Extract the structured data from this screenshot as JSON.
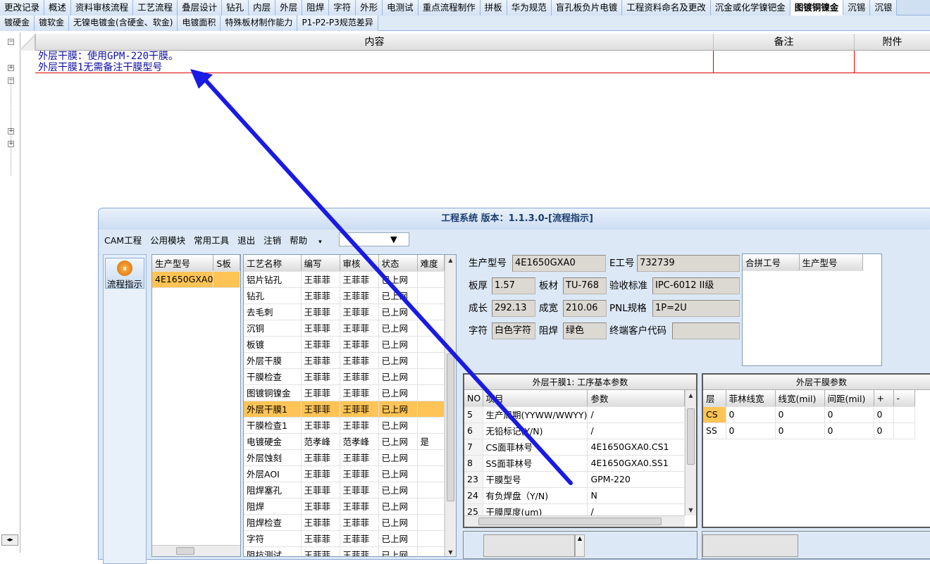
{
  "tabs_row1": [
    "更改记录",
    "概述",
    "资料审核流程",
    "工艺流程",
    "叠层设计",
    "钻孔",
    "内层",
    "外层",
    "阻焊",
    "字符",
    "外形",
    "电测试",
    "重点流程制作",
    "拼板",
    "华为规范",
    "盲孔板负片电镀",
    "工程资料命名及更改",
    "沉金或化学镍钯金",
    "图镀铜镍金",
    "沉锡",
    "沉银"
  ],
  "tabs_row1_active": "图镀铜镍金",
  "tabs_row2": [
    "镀硬金",
    "镀软金",
    "无镍电镀金(含硬金、软金)",
    "电镀面积",
    "特殊板材制作能力",
    "P1-P2-P3规范差异"
  ],
  "grid": {
    "col_content": "内容",
    "col_remark": "备注",
    "col_attach": "附件",
    "line1": "外层干膜：使用GPM-220干膜。",
    "line2": "外层干膜1无需备注干膜型号"
  },
  "window": {
    "title": "工程系统 版本：1.1.3.0-[流程指示]",
    "menu": [
      "CAM工程",
      "公用模块",
      "常用工具",
      "退出",
      "注销",
      "帮助"
    ],
    "side_button": "流程指示"
  },
  "product_list": {
    "headers": [
      "生产型号",
      "S板"
    ],
    "rows": [
      [
        "4E1650GXA0",
        ""
      ]
    ]
  },
  "process_table": {
    "headers": [
      "工艺名称",
      "编写",
      "审核",
      "状态",
      "难度"
    ],
    "rows": [
      [
        "铝片钻孔",
        "王菲菲",
        "王菲菲",
        "已上网",
        ""
      ],
      [
        "钻孔",
        "王菲菲",
        "王菲菲",
        "已上网",
        ""
      ],
      [
        "去毛刺",
        "王菲菲",
        "王菲菲",
        "已上网",
        ""
      ],
      [
        "沉铜",
        "王菲菲",
        "王菲菲",
        "已上网",
        ""
      ],
      [
        "板镀",
        "王菲菲",
        "王菲菲",
        "已上网",
        ""
      ],
      [
        "外层干膜",
        "王菲菲",
        "王菲菲",
        "已上网",
        ""
      ],
      [
        "干膜检查",
        "王菲菲",
        "王菲菲",
        "已上网",
        ""
      ],
      [
        "图镀铜镍金",
        "王菲菲",
        "王菲菲",
        "已上网",
        ""
      ],
      [
        "外层干膜1",
        "王菲菲",
        "王菲菲",
        "已上网",
        ""
      ],
      [
        "干膜检查1",
        "王菲菲",
        "王菲菲",
        "已上网",
        ""
      ],
      [
        "电镀硬金",
        "范孝峰",
        "范孝峰",
        "已上网",
        "是"
      ],
      [
        "外层蚀刻",
        "王菲菲",
        "王菲菲",
        "已上网",
        ""
      ],
      [
        "外层AOI",
        "王菲菲",
        "王菲菲",
        "已上网",
        ""
      ],
      [
        "阻焊塞孔",
        "王菲菲",
        "王菲菲",
        "已上网",
        ""
      ],
      [
        "阻焊",
        "王菲菲",
        "王菲菲",
        "已上网",
        ""
      ],
      [
        "阻焊检查",
        "王菲菲",
        "王菲菲",
        "已上网",
        ""
      ],
      [
        "字符",
        "王菲菲",
        "王菲菲",
        "已上网",
        ""
      ],
      [
        "阻抗测试",
        "王菲菲",
        "王菲菲",
        "已上网",
        ""
      ]
    ],
    "selected_index": 8
  },
  "info": {
    "model_label": "生产型号",
    "model": "4E1650GXA0",
    "eno_label": "E工号",
    "eno": "732739",
    "thick_label": "板厚",
    "thick": "1.57",
    "mat_label": "板材",
    "mat": "TU-768",
    "std_label": "验收标准",
    "std": "IPC-6012 II级",
    "len_label": "成长",
    "len": "292.13",
    "wid_label": "成宽",
    "wid": "210.06",
    "pnl_label": "PNL规格",
    "pnl": "1P=2U",
    "char_label": "字符",
    "char": "白色字符",
    "mask_label": "阻焊",
    "mask": "绿色",
    "cust_label": "终端客户代码",
    "cust": "",
    "merge_headers": [
      "合拼工号",
      "生产型号"
    ]
  },
  "params": {
    "title": "外层干膜1: 工序基本参数",
    "headers": [
      "NO",
      "项目",
      "参数"
    ],
    "rows": [
      [
        "5",
        "生产周期(YYWW/WWYY)",
        "/"
      ],
      [
        "6",
        "无铅标记(Y/N)",
        "/"
      ],
      [
        "7",
        "CS面菲林号",
        "4E1650GXA0.CS1"
      ],
      [
        "8",
        "SS面菲林号",
        "4E1650GXA0.SS1"
      ],
      [
        "23",
        "干膜型号",
        "GPM-220"
      ],
      [
        "24",
        "有负焊盘（Y/N)",
        "N"
      ],
      [
        "25",
        "干膜厚度(um)",
        "/"
      ]
    ]
  },
  "film": {
    "title": "外层干膜参数",
    "headers": [
      "层",
      "菲林线宽",
      "线宽(mil)",
      "间距(mil)",
      "+",
      "-"
    ],
    "rows": [
      [
        "CS",
        "0",
        "0",
        "0",
        "0",
        ""
      ],
      [
        "SS",
        "0",
        "0",
        "0",
        "0",
        ""
      ]
    ]
  },
  "colors": {
    "annotation_arrow": "#1a1ae6",
    "selection": "#ffc455",
    "remark_border": "#dd0000"
  }
}
